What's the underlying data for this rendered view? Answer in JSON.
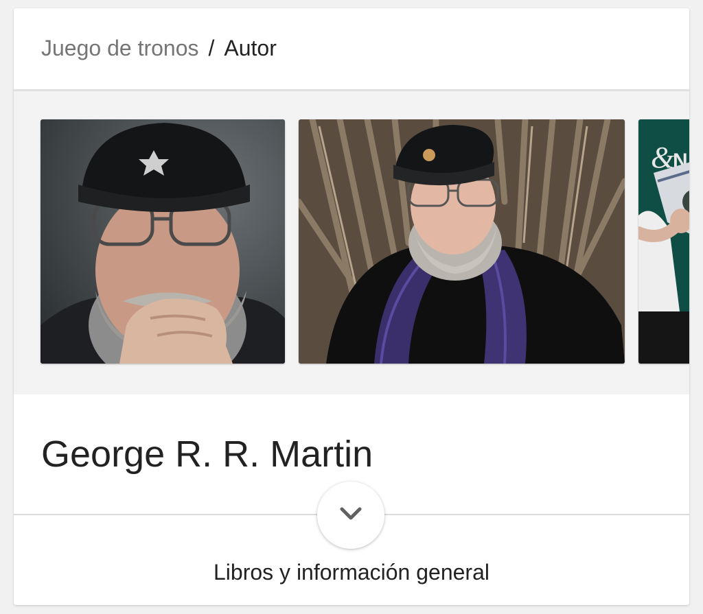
{
  "breadcrumb": {
    "parent": "Juego de tronos",
    "separator": "/",
    "current": "Autor"
  },
  "gallery": {
    "photos": [
      {
        "description_icon": "author-portrait-photo"
      },
      {
        "description_icon": "author-iron-throne-photo"
      },
      {
        "description_icon": "author-book-signing-photo"
      }
    ]
  },
  "entity": {
    "name": "George R. R. Martin"
  },
  "expand": {
    "icon": "chevron-down-icon"
  },
  "section": {
    "label": "Libros y información general"
  }
}
